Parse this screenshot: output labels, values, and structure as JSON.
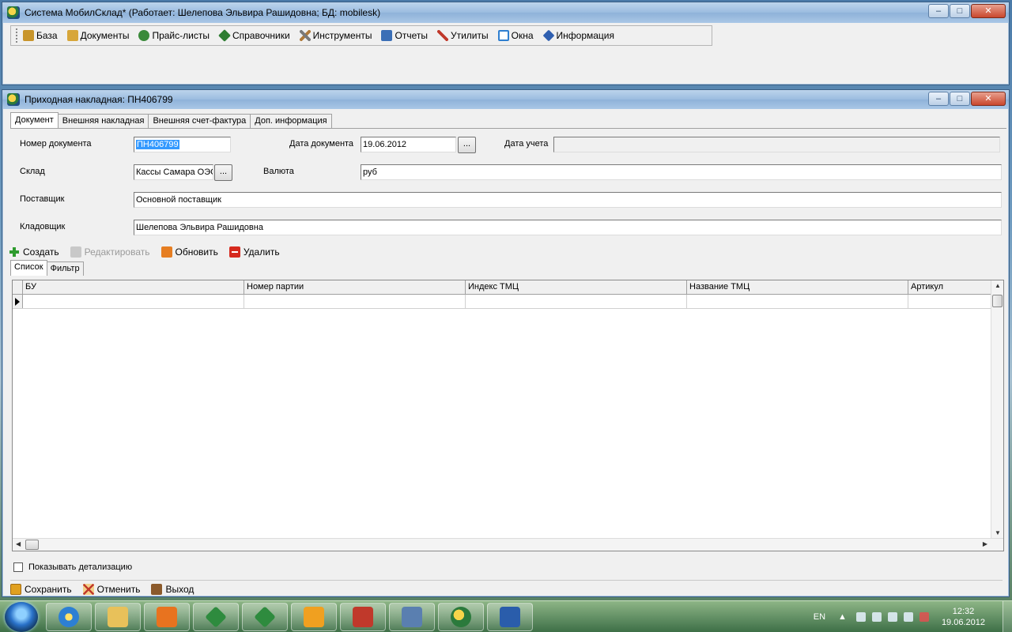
{
  "main_window": {
    "title": "Система МобилСклад* (Работает: Шелепова Эльвира Рашидовна; БД: mobilesk)",
    "caption_buttons": {
      "minimize": "–",
      "maximize": "□",
      "close": "✕"
    },
    "menu": [
      {
        "label": "База",
        "icon": "database-icon",
        "color": "#c8952b"
      },
      {
        "label": "Документы",
        "icon": "documents-icon",
        "color": "#d7a63a"
      },
      {
        "label": "Прайс-листы",
        "icon": "price-list-icon",
        "color": "#3a8a3a"
      },
      {
        "label": "Справочники",
        "icon": "reference-books-icon",
        "color": "#2e7d32"
      },
      {
        "label": "Инструменты",
        "icon": "tools-icon",
        "color": "#7a7a7a"
      },
      {
        "label": "Отчеты",
        "icon": "reports-icon",
        "color": "#3b6fb6"
      },
      {
        "label": "Утилиты",
        "icon": "utilities-icon",
        "color": "#c0392b"
      },
      {
        "label": "Окна",
        "icon": "windows-icon",
        "color": "#2f7fd0"
      },
      {
        "label": "Информация",
        "icon": "info-icon",
        "color": "#2f5fb0"
      }
    ]
  },
  "doc_window": {
    "title": "Приходная накладная: ПН406799",
    "caption_buttons": {
      "minimize": "–",
      "maximize": "□",
      "close": "✕"
    },
    "tabs": [
      "Документ",
      "Внешняя накладная",
      "Внешняя счет-фактура",
      "Доп. информация"
    ],
    "form": {
      "doc_number_label": "Номер документа",
      "doc_number_value": "ПН406799",
      "doc_date_label": "Дата документа",
      "doc_date_value": "19.06.2012",
      "account_date_label": "Дата учета",
      "account_date_value": "",
      "warehouse_label": "Склад",
      "warehouse_value": "Кассы Самара ОЭС",
      "currency_label": "Валюта",
      "currency_value": "руб",
      "supplier_label": "Поставщик",
      "supplier_value": "Основной поставщик",
      "storekeeper_label": "Кладовщик",
      "storekeeper_value": "Шелепова Эльвира Рашидовна",
      "ellipsis": "..."
    },
    "toolbar": [
      {
        "label": "Создать",
        "icon": "add-icon",
        "color": "#2e9b2e",
        "enabled": true
      },
      {
        "label": "Редактировать",
        "icon": "edit-icon",
        "color": "#b8b8b8",
        "enabled": false
      },
      {
        "label": "Обновить",
        "icon": "refresh-icon",
        "color": "#e67e22",
        "enabled": true
      },
      {
        "label": "Удалить",
        "icon": "delete-icon",
        "color": "#d62a1e",
        "enabled": true
      }
    ],
    "subtabs": [
      "Список",
      "Фильтр"
    ],
    "grid": {
      "columns": [
        "БУ",
        "Номер партии",
        "Индекс ТМЦ",
        "Название ТМЦ",
        "Артикул"
      ]
    },
    "show_detail_label": "Показывать детализацию",
    "bottom_buttons": [
      {
        "label": "Сохранить",
        "icon": "save-icon",
        "color": "#e0a020"
      },
      {
        "label": "Отменить",
        "icon": "cancel-icon",
        "color": "#e0a020"
      },
      {
        "label": "Выход",
        "icon": "exit-icon",
        "color": "#8b5a2b"
      }
    ]
  },
  "taskbar": {
    "apps": [
      {
        "name": "internet-explorer-icon",
        "color": "#2d7fd3"
      },
      {
        "name": "file-explorer-icon",
        "color": "#e8c15a"
      },
      {
        "name": "media-player-icon",
        "color": "#e8731f"
      },
      {
        "name": "app-window-1-icon",
        "color": "#2e8b3e"
      },
      {
        "name": "app-window-2-icon",
        "color": "#2e8b3e"
      },
      {
        "name": "outlook-icon",
        "color": "#f0a020"
      },
      {
        "name": "solitaire-icon",
        "color": "#c0392b"
      },
      {
        "name": "tool-app-icon",
        "color": "#5a7fb0"
      },
      {
        "name": "mobilsklad-icon",
        "color": "#2b7a3c"
      },
      {
        "name": "word-icon",
        "color": "#2a5dab"
      }
    ],
    "lang": "EN",
    "time": "12:32",
    "date": "19.06.2012"
  }
}
